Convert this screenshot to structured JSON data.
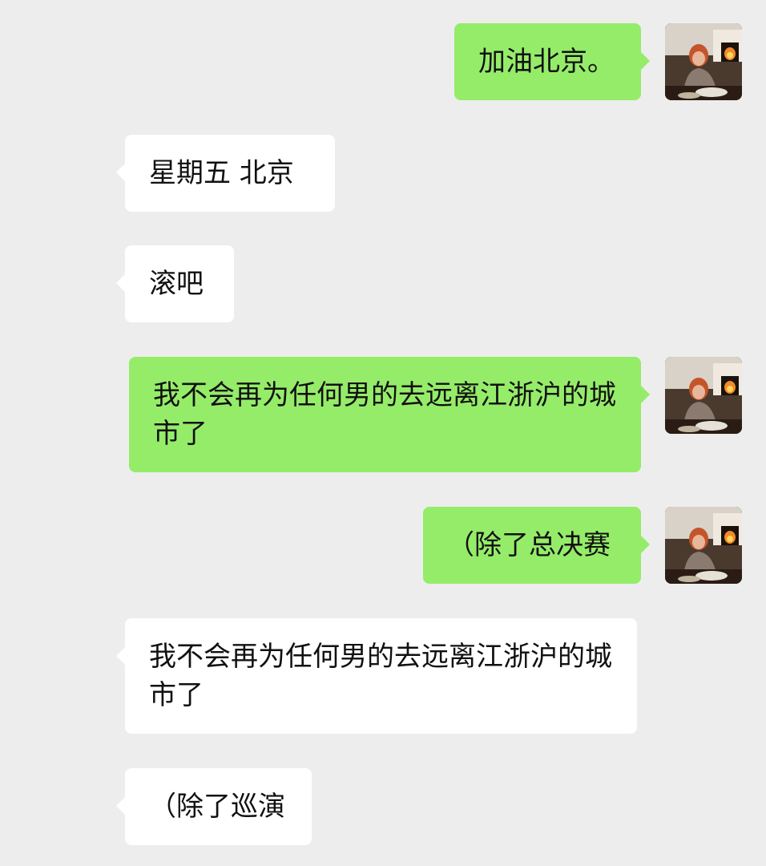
{
  "messages": [
    {
      "side": "sent",
      "text": "加油北京。",
      "has_avatar": true
    },
    {
      "side": "received",
      "text": "星期五 北京",
      "has_avatar": false
    },
    {
      "side": "received",
      "text": "滚吧",
      "has_avatar": false
    },
    {
      "side": "sent",
      "text": "我不会再为任何男的去远离江浙沪的城市了",
      "has_avatar": true
    },
    {
      "side": "sent",
      "text": "（除了总决赛",
      "has_avatar": true
    },
    {
      "side": "received",
      "text": "我不会再为任何男的去远离江浙沪的城市了",
      "has_avatar": false
    },
    {
      "side": "received",
      "text": "（除了巡演",
      "has_avatar": false
    }
  ],
  "colors": {
    "background": "#ededed",
    "sent_bubble": "#95ec69",
    "received_bubble": "#ffffff",
    "text": "#111111"
  },
  "avatar_icon": "user-photo-avatar"
}
